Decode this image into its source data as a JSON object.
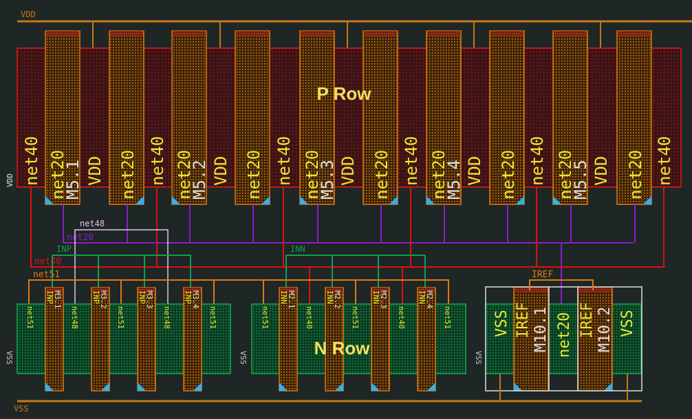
{
  "rails": {
    "vdd": "VDD",
    "vss": "VSS"
  },
  "side_labels": {
    "p_row": "VDD",
    "n_row": [
      "VSS",
      "VSS",
      "VSS"
    ]
  },
  "row_titles": {
    "p": "P Row",
    "n": "N Row"
  },
  "p_row": {
    "diffusion": [
      "net40",
      "VDD",
      "net40",
      "VDD",
      "net40",
      "VDD",
      "net40",
      "VDD",
      "net40",
      "VDD",
      "net40"
    ],
    "gates": [
      {
        "net": "net20",
        "name": "M5.1"
      },
      {
        "net": "net20"
      },
      {
        "net": "net20",
        "name": "M5.2"
      },
      {
        "net": "net20"
      },
      {
        "net": "net20",
        "name": "M5.3"
      },
      {
        "net": "net20"
      },
      {
        "net": "net20",
        "name": "M5.4"
      },
      {
        "net": "net20"
      },
      {
        "net": "net20",
        "name": "M5.5"
      },
      {
        "net": "net20"
      }
    ]
  },
  "n_row_left": {
    "diffusion": [
      "net51",
      "net48",
      "net51",
      "net48",
      "net51"
    ],
    "gates": [
      {
        "net": "INP",
        "name": "M3.1"
      },
      {
        "net": "INP",
        "name": "M3.2"
      },
      {
        "net": "INP",
        "name": "M3.3"
      },
      {
        "net": "INP",
        "name": "M3.4"
      }
    ]
  },
  "n_row_right": {
    "diffusion": [
      "net51",
      "net40",
      "net51",
      "net40",
      "net51"
    ],
    "gates": [
      {
        "net": "INN",
        "name": "M2.1"
      },
      {
        "net": "INN",
        "name": "M2.2"
      },
      {
        "net": "INN",
        "name": "M2.3"
      },
      {
        "net": "INN",
        "name": "M2.4"
      }
    ]
  },
  "iref_block": {
    "diffusion": [
      "VSS",
      "net20",
      "VSS"
    ],
    "gates": [
      {
        "net": "IREF",
        "name": "M10.1"
      },
      {
        "net": "IREF",
        "name": "M10.2"
      }
    ]
  },
  "net_labels": {
    "net48": "net48",
    "net20": "net20",
    "inp": "INP",
    "inn": "INN",
    "net40": "net40",
    "net51": "net51",
    "iref": "IREF"
  },
  "colors": {
    "background": "#1e2626",
    "rail": "#c87814",
    "net40": "#e01010",
    "net20": "#8a1ec8",
    "net48": "#e8c0e8",
    "inp_inn": "#10a050",
    "net51": "#e07a10",
    "label": "#e8e830",
    "device_name": "#e0e0e0",
    "p_diffusion": "#e01818",
    "n_diffusion": "#10b050",
    "gate": "#e07a10",
    "corner_marker": "#30b0f0"
  }
}
